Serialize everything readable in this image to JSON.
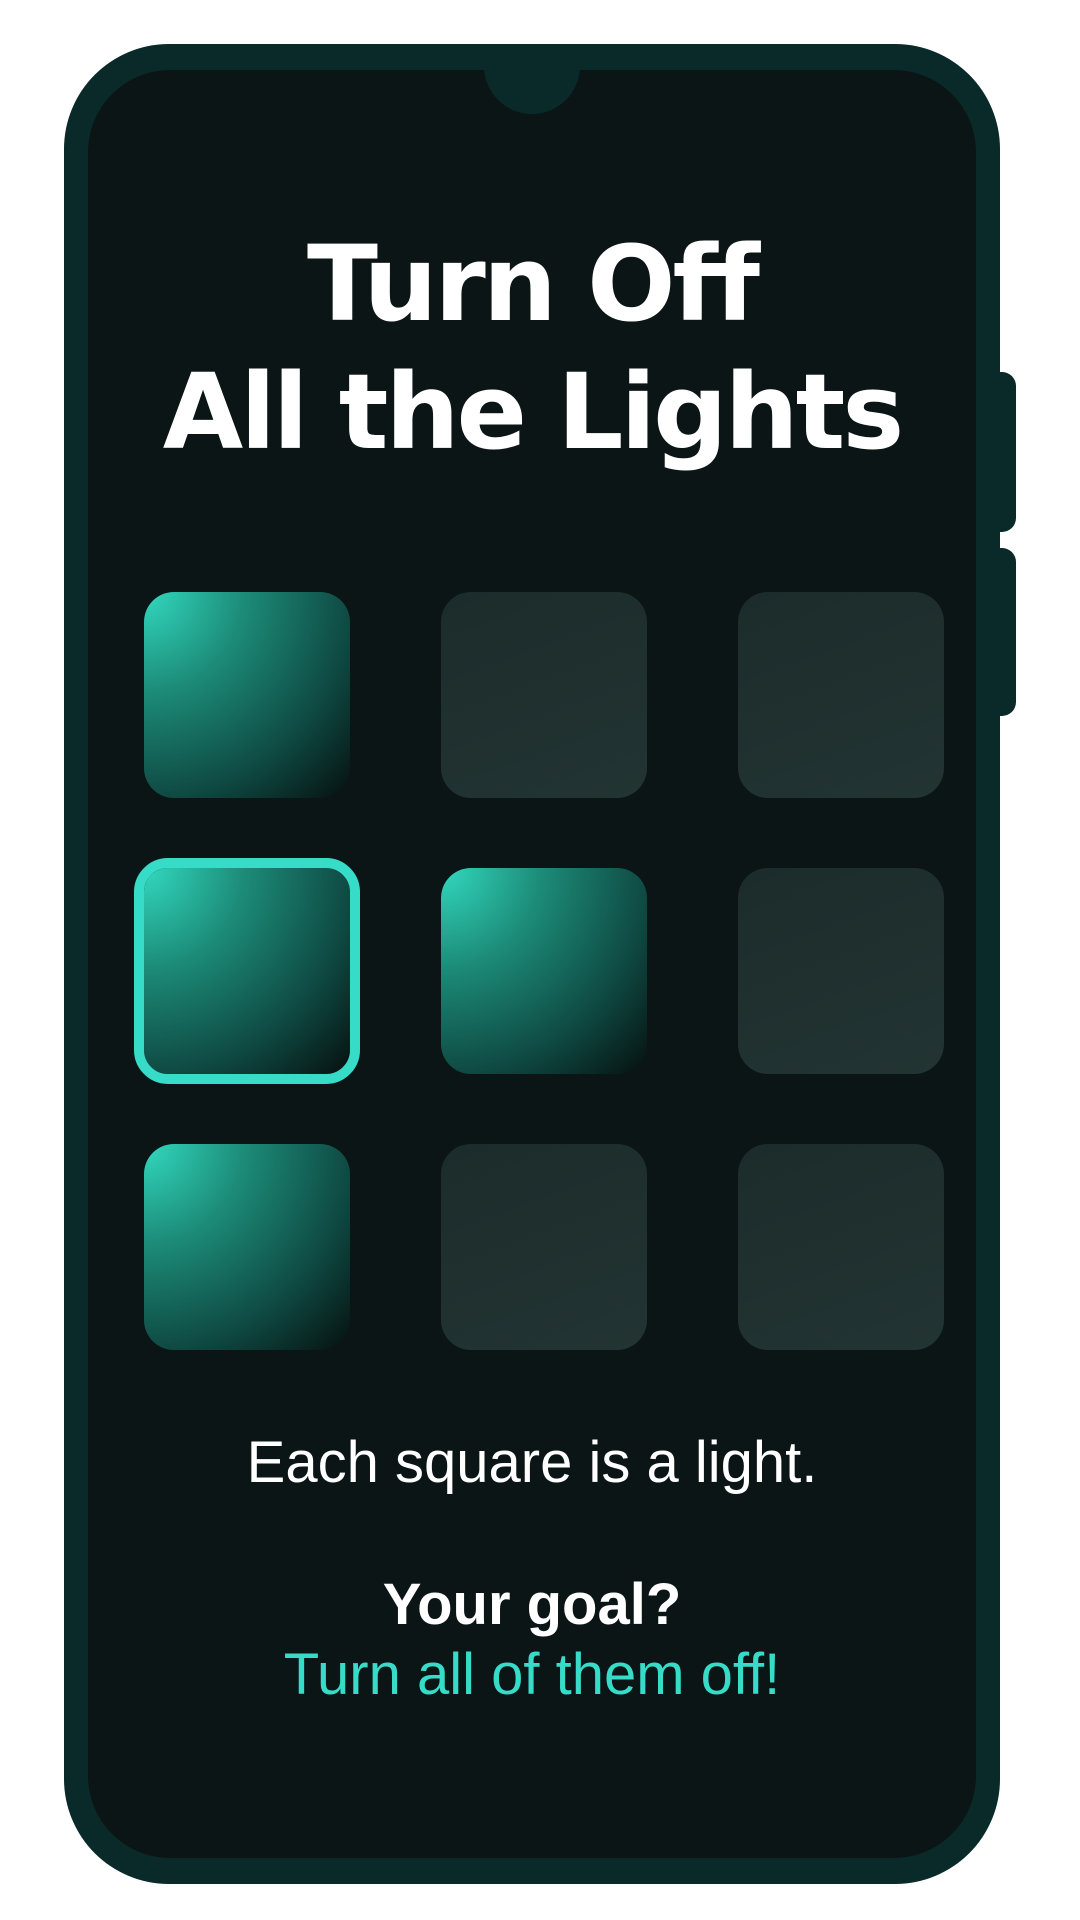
{
  "title": {
    "line1": "Turn Off",
    "line2": "All the Lights"
  },
  "grid": {
    "rows": 3,
    "cols": 3,
    "cells": [
      {
        "row": 1,
        "col": 1,
        "state": "on",
        "selected": false
      },
      {
        "row": 1,
        "col": 2,
        "state": "off",
        "selected": false
      },
      {
        "row": 1,
        "col": 3,
        "state": "off",
        "selected": false
      },
      {
        "row": 2,
        "col": 1,
        "state": "on",
        "selected": true
      },
      {
        "row": 2,
        "col": 2,
        "state": "on",
        "selected": false
      },
      {
        "row": 2,
        "col": 3,
        "state": "off",
        "selected": false
      },
      {
        "row": 3,
        "col": 1,
        "state": "on",
        "selected": false
      },
      {
        "row": 3,
        "col": 2,
        "state": "off",
        "selected": false
      },
      {
        "row": 3,
        "col": 3,
        "state": "off",
        "selected": false
      }
    ]
  },
  "instructions": {
    "line1": "Each square is a light.",
    "line2": "Your goal?",
    "line3": "Turn all of them off!"
  },
  "colors": {
    "accent": "#36dcc8",
    "phone_frame": "#0a2a29",
    "screen_bg": "#0b1516",
    "light_off": "#1f3130"
  }
}
